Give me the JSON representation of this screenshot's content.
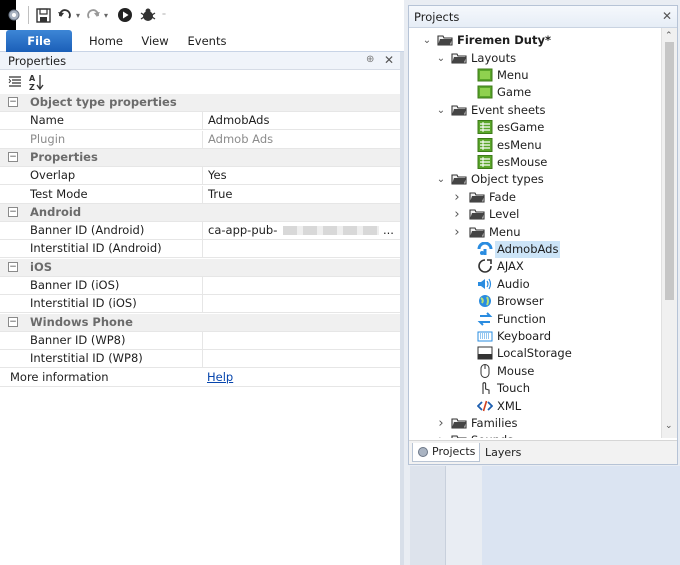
{
  "ribbon": {
    "file": "File",
    "home": "Home",
    "view": "View",
    "events": "Events"
  },
  "properties_panel": {
    "title": "Properties",
    "pin_glyph": "⊕",
    "close_glyph": "✕",
    "sort_icon_label": "A↓Z",
    "groups": [
      {
        "label": "Object type properties",
        "toggle": "−",
        "rows": [
          {
            "key": "Name",
            "value": "AdmobAds",
            "value_grey": false
          },
          {
            "key": "Plugin",
            "value": "Admob Ads",
            "value_grey": true
          }
        ]
      },
      {
        "label": "Properties",
        "toggle": "−",
        "rows": [
          {
            "key": "Overlap",
            "value": "Yes"
          },
          {
            "key": "Test Mode",
            "value": "True"
          }
        ]
      },
      {
        "label": "Android",
        "toggle": "−",
        "rows": [
          {
            "key": "Banner ID (Android)",
            "value": "ca-app-pub-",
            "ellipsis": "..."
          },
          {
            "key": "Interstitial ID (Android)",
            "value": ""
          }
        ]
      },
      {
        "label": "iOS",
        "toggle": "−",
        "rows": [
          {
            "key": "Banner ID (iOS)",
            "value": ""
          },
          {
            "key": "Interstitial ID (iOS)",
            "value": ""
          }
        ]
      },
      {
        "label": "Windows Phone",
        "toggle": "−",
        "rows": [
          {
            "key": "Banner ID (WP8)",
            "value": ""
          },
          {
            "key": "Interstitial ID (WP8)",
            "value": ""
          }
        ]
      }
    ],
    "more_info": {
      "key": "More information",
      "link": "Help"
    }
  },
  "projects_panel": {
    "title": "Projects",
    "close_glyph": "✕",
    "root": "Firemen Duty*",
    "tree": [
      {
        "label": "Layouts",
        "level": 1,
        "arrow": "⌄",
        "icon": "folder-icon"
      },
      {
        "label": "Menu",
        "level": 2,
        "icon": "layout-icon"
      },
      {
        "label": "Game",
        "level": 2,
        "icon": "layout-icon"
      },
      {
        "label": "Event sheets",
        "level": 1,
        "arrow": "⌄",
        "icon": "folder-icon"
      },
      {
        "label": "esGame",
        "level": 2,
        "icon": "event-sheet-icon"
      },
      {
        "label": "esMenu",
        "level": 2,
        "icon": "event-sheet-icon"
      },
      {
        "label": "esMouse",
        "level": 2,
        "icon": "event-sheet-icon"
      },
      {
        "label": "Object types",
        "level": 1,
        "arrow": "⌄",
        "icon": "folder-icon"
      },
      {
        "label": "Fade",
        "level": 2,
        "arrow": ">",
        "icon": "folder-icon"
      },
      {
        "label": "Level",
        "level": 2,
        "arrow": ">",
        "icon": "folder-icon"
      },
      {
        "label": "Menu",
        "level": 2,
        "arrow": ">",
        "icon": "folder-icon"
      },
      {
        "label": "AdmobAds",
        "level": 2,
        "icon": "admob-icon",
        "selected": true
      },
      {
        "label": "AJAX",
        "level": 2,
        "icon": "ajax-icon"
      },
      {
        "label": "Audio",
        "level": 2,
        "icon": "audio-icon"
      },
      {
        "label": "Browser",
        "level": 2,
        "icon": "browser-icon"
      },
      {
        "label": "Function",
        "level": 2,
        "icon": "function-icon"
      },
      {
        "label": "Keyboard",
        "level": 2,
        "icon": "keyboard-icon"
      },
      {
        "label": "LocalStorage",
        "level": 2,
        "icon": "localstorage-icon"
      },
      {
        "label": "Mouse",
        "level": 2,
        "icon": "mouse-icon"
      },
      {
        "label": "Touch",
        "level": 2,
        "icon": "touch-icon"
      },
      {
        "label": "XML",
        "level": 2,
        "icon": "xml-icon"
      },
      {
        "label": "Families",
        "level": 1,
        "arrow": ">",
        "icon": "folder-icon"
      },
      {
        "label": "Sounds",
        "level": 1,
        "arrow": ">",
        "icon": "folder-icon"
      }
    ],
    "tabs": {
      "projects": "Projects",
      "layers": "Layers"
    }
  },
  "colors": {
    "selection": "#cce4f7",
    "link": "#0645ad",
    "file_tab": "#2a6fc7"
  }
}
